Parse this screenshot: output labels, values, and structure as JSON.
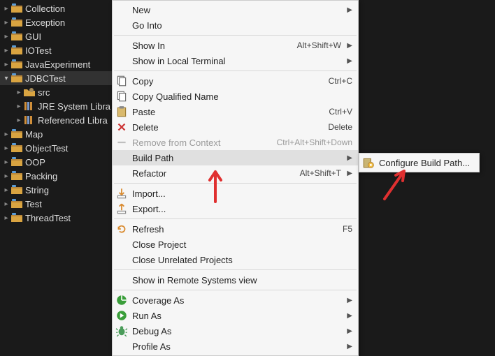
{
  "tree": {
    "items": [
      {
        "label": "Collection",
        "level": 1,
        "expanded": false,
        "icon": "project"
      },
      {
        "label": "Exception",
        "level": 1,
        "expanded": false,
        "icon": "project"
      },
      {
        "label": "GUI",
        "level": 1,
        "expanded": false,
        "icon": "project"
      },
      {
        "label": "IOTest",
        "level": 1,
        "expanded": false,
        "icon": "project"
      },
      {
        "label": "JavaExperiment",
        "level": 1,
        "expanded": false,
        "icon": "project"
      },
      {
        "label": "JDBCTest",
        "level": 1,
        "expanded": true,
        "icon": "project",
        "selected": true
      },
      {
        "label": "src",
        "level": 2,
        "expanded": false,
        "icon": "package"
      },
      {
        "label": "JRE System Libra",
        "level": 2,
        "expanded": false,
        "icon": "library"
      },
      {
        "label": "Referenced Libra",
        "level": 2,
        "expanded": false,
        "icon": "library"
      },
      {
        "label": "Map",
        "level": 1,
        "expanded": false,
        "icon": "project"
      },
      {
        "label": "ObjectTest",
        "level": 1,
        "expanded": false,
        "icon": "project"
      },
      {
        "label": "OOP",
        "level": 1,
        "expanded": false,
        "icon": "project"
      },
      {
        "label": "Packing",
        "level": 1,
        "expanded": false,
        "icon": "project"
      },
      {
        "label": "String",
        "level": 1,
        "expanded": false,
        "icon": "project"
      },
      {
        "label": "Test",
        "level": 1,
        "expanded": false,
        "icon": "project"
      },
      {
        "label": "ThreadTest",
        "level": 1,
        "expanded": false,
        "icon": "project"
      }
    ]
  },
  "menu": {
    "items": [
      {
        "label": "New",
        "submenu": true
      },
      {
        "label": "Go Into"
      },
      {
        "sep": true
      },
      {
        "label": "Show In",
        "accel": "Alt+Shift+W",
        "submenu": true
      },
      {
        "label": "Show in Local Terminal",
        "submenu": true
      },
      {
        "sep": true
      },
      {
        "label": "Copy",
        "accel": "Ctrl+C",
        "icon": "copy"
      },
      {
        "label": "Copy Qualified Name",
        "icon": "copy"
      },
      {
        "label": "Paste",
        "accel": "Ctrl+V",
        "icon": "paste"
      },
      {
        "label": "Delete",
        "accel": "Delete",
        "icon": "delete"
      },
      {
        "label": "Remove from Context",
        "accel": "Ctrl+Alt+Shift+Down",
        "icon": "remove",
        "disabled": true
      },
      {
        "label": "Build Path",
        "submenu": true,
        "highlighted": true
      },
      {
        "label": "Refactor",
        "accel": "Alt+Shift+T",
        "submenu": true
      },
      {
        "sep": true
      },
      {
        "label": "Import...",
        "icon": "import"
      },
      {
        "label": "Export...",
        "icon": "export"
      },
      {
        "sep": true
      },
      {
        "label": "Refresh",
        "accel": "F5",
        "icon": "refresh"
      },
      {
        "label": "Close Project"
      },
      {
        "label": "Close Unrelated Projects"
      },
      {
        "sep": true
      },
      {
        "label": "Show in Remote Systems view"
      },
      {
        "sep": true
      },
      {
        "label": "Coverage As",
        "submenu": true,
        "icon": "coverage"
      },
      {
        "label": "Run As",
        "submenu": true,
        "icon": "run"
      },
      {
        "label": "Debug As",
        "submenu": true,
        "icon": "debug"
      },
      {
        "label": "Profile As",
        "submenu": true
      }
    ]
  },
  "submenu": {
    "items": [
      {
        "label": "Configure Build Path...",
        "icon": "configure"
      }
    ]
  }
}
